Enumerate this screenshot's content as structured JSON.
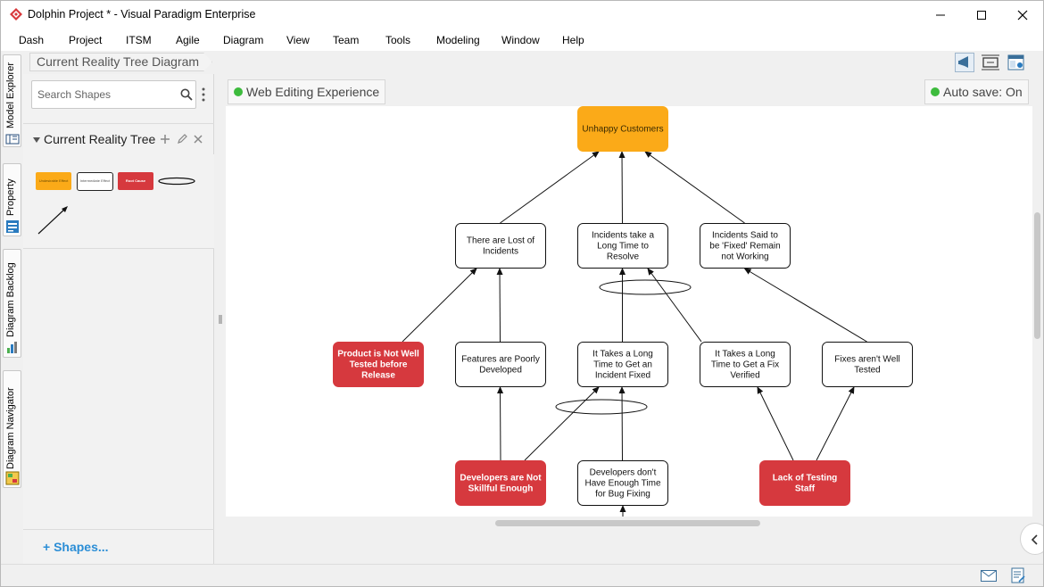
{
  "window": {
    "title": "Dolphin Project * - Visual Paradigm Enterprise",
    "controls": [
      "minimize-icon",
      "maximize-icon",
      "close-icon"
    ]
  },
  "menu": {
    "items": [
      "Dash",
      "Project",
      "ITSM",
      "Agile",
      "Diagram",
      "View",
      "Team",
      "Tools",
      "Modeling",
      "Window",
      "Help"
    ]
  },
  "side_tabs": {
    "items": [
      {
        "label": "Model Explorer",
        "icon": "model-explorer-icon"
      },
      {
        "label": "Property",
        "icon": "property-icon"
      },
      {
        "label": "Diagram Backlog",
        "icon": "diagram-backlog-icon"
      },
      {
        "label": "Diagram Navigator",
        "icon": "diagram-navigator-icon"
      }
    ]
  },
  "breadcrumb": {
    "label": "Current Reality Tree Diagram"
  },
  "toolbar": {
    "icons": [
      "announcement-icon",
      "fit-to-window-icon",
      "layout-settings-icon"
    ]
  },
  "shapes_panel": {
    "search_placeholder": "Search Shapes",
    "group_title": "Current Reality Tree",
    "group_actions": [
      "add-icon",
      "edit-icon",
      "close-icon"
    ],
    "palette": [
      {
        "label": "Undesirable Effect",
        "fill": "#fbaa18",
        "text_color": "#6b4a00"
      },
      {
        "label": "Intermediate Effect",
        "fill": "#ffffff",
        "text_color": "#555555"
      },
      {
        "label": "Root Cause",
        "fill": "#d6393e",
        "text_color": "#ffffff"
      },
      {
        "label": "",
        "shape": "ellipse"
      },
      {
        "label": "",
        "shape": "arrow"
      }
    ],
    "more_shapes_label": "Shapes..."
  },
  "canvas": {
    "diagram_name": "Web Editing Experience",
    "autosave_label": "Auto save: On",
    "colors": {
      "undesirable_effect": "#fbaa18",
      "root_cause": "#d6393e",
      "intermediate": "#ffffff"
    },
    "nodes": [
      {
        "id": "unhappy",
        "text": "Unhappy Customers",
        "kind": "undesirable"
      },
      {
        "id": "lost",
        "text": "There are Lost of Incidents",
        "kind": "intermediate"
      },
      {
        "id": "long",
        "text": "Incidents take a Long Time to Resolve",
        "kind": "intermediate"
      },
      {
        "id": "fixednot",
        "text": "Incidents Said to be 'Fixed' Remain not Working",
        "kind": "intermediate"
      },
      {
        "id": "product",
        "text": "Product is Not Well Tested before Release",
        "kind": "root"
      },
      {
        "id": "features",
        "text": "Features are Poorly Developed",
        "kind": "intermediate"
      },
      {
        "id": "takeslong",
        "text": "It Takes a Long Time to Get an Incident Fixed",
        "kind": "intermediate"
      },
      {
        "id": "fixverified",
        "text": "It Takes a Long Time to Get a Fix Verified",
        "kind": "intermediate"
      },
      {
        "id": "fixesnot",
        "text": "Fixes aren't Well Tested",
        "kind": "intermediate"
      },
      {
        "id": "devskill",
        "text": "Developers are Not Skillful Enough",
        "kind": "root"
      },
      {
        "id": "devtime",
        "text": "Developers don't Have Enough Time for Bug Fixing",
        "kind": "intermediate"
      },
      {
        "id": "lackstaff",
        "text": "Lack of Testing Staff",
        "kind": "root"
      }
    ],
    "edges": [
      [
        "lost",
        "unhappy"
      ],
      [
        "long",
        "unhappy"
      ],
      [
        "fixednot",
        "unhappy"
      ],
      [
        "product",
        "lost"
      ],
      [
        "features",
        "lost"
      ],
      [
        "takeslong",
        "long"
      ],
      [
        "fixverified",
        "long"
      ],
      [
        "fixesnot",
        "fixednot"
      ],
      [
        "devskill",
        "features"
      ],
      [
        "devskill",
        "takeslong"
      ],
      [
        "devtime",
        "takeslong"
      ],
      [
        "lackstaff",
        "fixverified"
      ],
      [
        "lackstaff",
        "fixesnot"
      ]
    ]
  },
  "statusbar": {
    "icons": [
      "mail-icon",
      "notes-icon"
    ]
  }
}
